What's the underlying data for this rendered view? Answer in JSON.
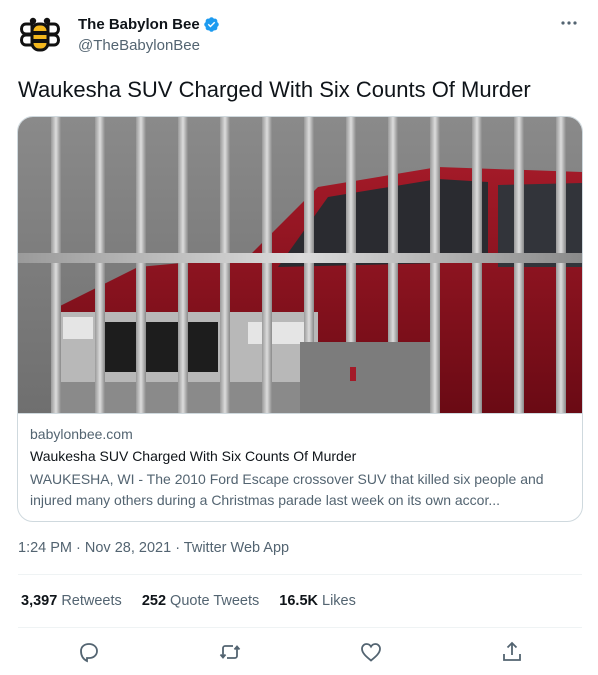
{
  "author": {
    "name": "The Babylon Bee",
    "handle": "@TheBabylonBee"
  },
  "tweet": {
    "text": "Waukesha SUV Charged With Six Counts Of Murder"
  },
  "card": {
    "domain": "babylonbee.com",
    "title": "Waukesha SUV Charged With Six Counts Of Murder",
    "description": "WAUKESHA, WI - The 2010 Ford Escape crossover SUV that killed six people and injured many others during a Christmas parade last week on its own accor..."
  },
  "meta": {
    "time": "1:24 PM",
    "date": "Nov 28, 2021",
    "source": "Twitter Web App"
  },
  "stats": {
    "retweets_count": "3,397",
    "retweets_label": "Retweets",
    "quotes_count": "252",
    "quotes_label": "Quote Tweets",
    "likes_count": "16.5K",
    "likes_label": "Likes"
  },
  "icons": {
    "avatar": "bee-logo-icon",
    "verified": "verified-badge-icon",
    "more": "more-icon",
    "reply": "reply-icon",
    "retweet": "retweet-icon",
    "like": "heart-icon",
    "share": "share-icon"
  },
  "colors": {
    "verified_blue": "#1d9bf0",
    "secondary_text": "#536471",
    "primary_text": "#0f1419",
    "border": "#cfd9de",
    "bee_yellow": "#f3b71d"
  }
}
